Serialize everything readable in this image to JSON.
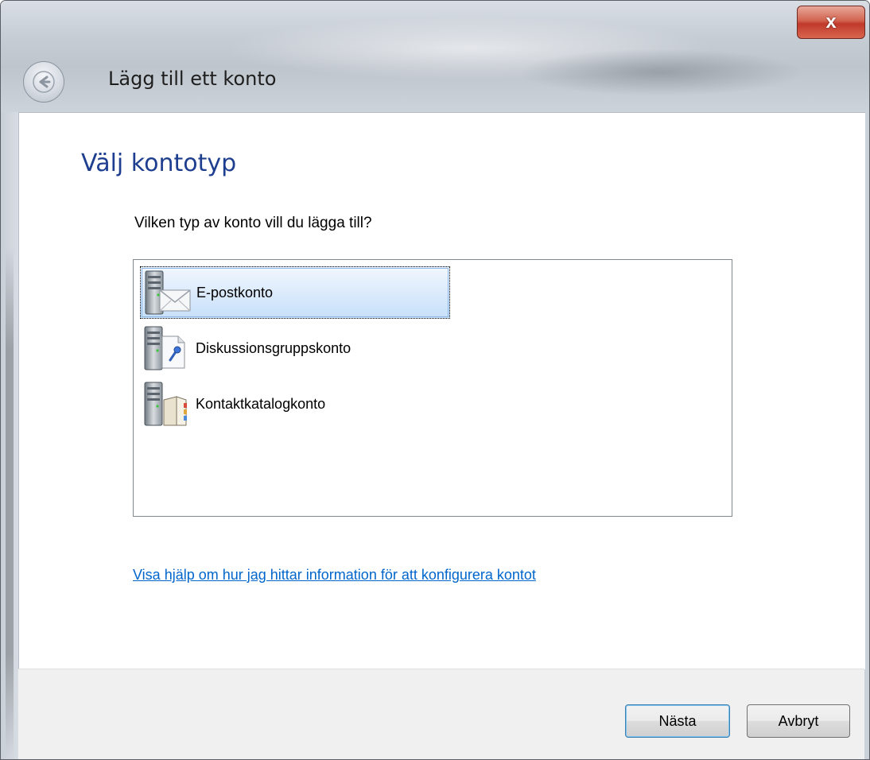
{
  "window": {
    "title": "Lägg till ett konto",
    "close_symbol": "x"
  },
  "page": {
    "heading": "Välj kontotyp",
    "question": "Vilken typ av konto vill du lägga till?"
  },
  "account_types": [
    {
      "label": "E-postkonto",
      "icon": "mail-server-icon",
      "selected": true
    },
    {
      "label": "Diskussionsgruppskonto",
      "icon": "newsgroup-server-icon",
      "selected": false
    },
    {
      "label": "Kontaktkatalogkonto",
      "icon": "directory-server-icon",
      "selected": false
    }
  ],
  "help_link": "Visa hjälp om hur jag hittar information för att konfigurera kontot",
  "buttons": {
    "next": "Nästa",
    "cancel": "Avbryt"
  },
  "colors": {
    "heading": "#1e3f8f",
    "link": "#0066cc",
    "selection": "#c7e0fa",
    "close": "#c0392b"
  }
}
